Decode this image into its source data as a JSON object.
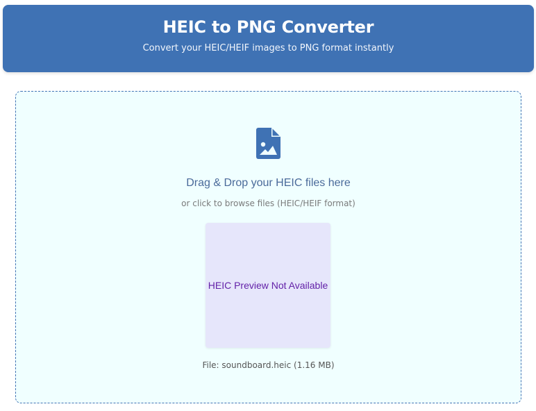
{
  "header": {
    "title": "HEIC to PNG Converter",
    "subtitle": "Convert your HEIC/HEIF images to PNG format instantly"
  },
  "dropzone": {
    "icon": "file-image-icon",
    "title": "Drag & Drop your HEIC files here",
    "hint": "or click to browse files (HEIC/HEIF format)",
    "preview_text": "HEIC Preview Not Available",
    "file_info": "File: soundboard.heic (1.16 MB)"
  },
  "colors": {
    "accent": "#3f72b4",
    "dropzone_bg": "#f0ffff",
    "preview_bg": "#e6e6fb",
    "preview_text": "#6321a8"
  }
}
